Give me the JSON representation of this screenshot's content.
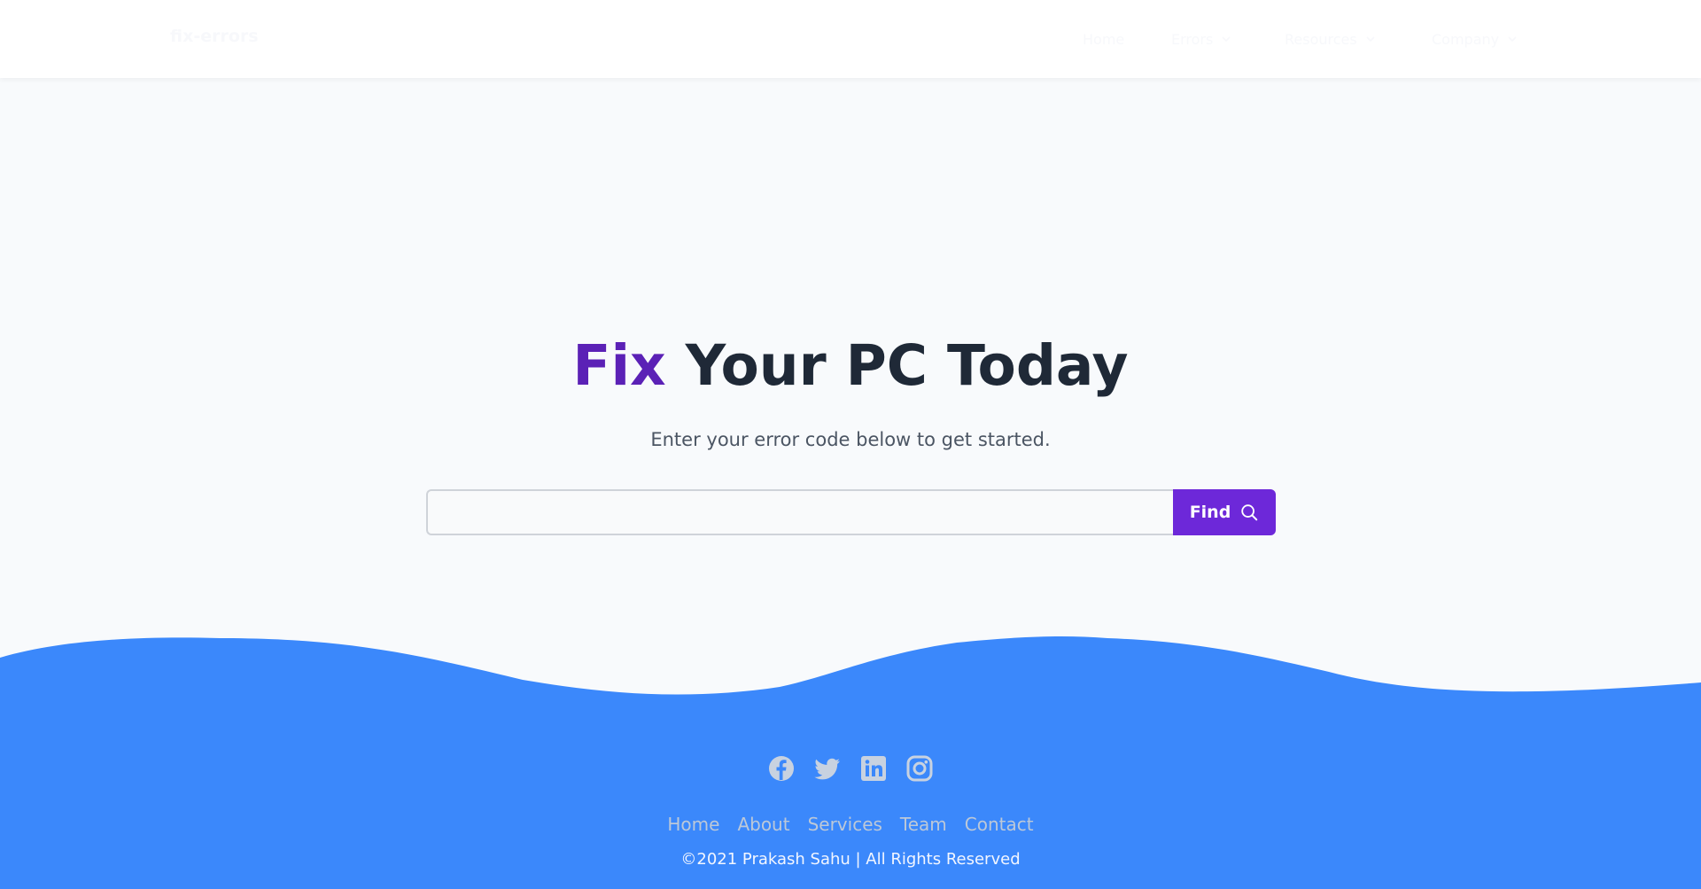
{
  "header": {
    "brand": "fix-errors",
    "nav": [
      {
        "label": "Home"
      },
      {
        "label": "Errors"
      },
      {
        "label": "Resources"
      },
      {
        "label": "Company"
      }
    ]
  },
  "hero": {
    "title_accent": "Fix",
    "title_rest": "Your PC Today",
    "subtitle": "Enter your error code below to get started.",
    "search": {
      "value": "",
      "placeholder": ""
    },
    "find_label": "Find"
  },
  "footer": {
    "social_icons": [
      "facebook-icon",
      "twitter-icon",
      "linkedin-icon",
      "instagram-icon"
    ],
    "links": [
      "Home",
      "About",
      "Services",
      "Team",
      "Contact"
    ],
    "copyright": "©2021 Prakash Sahu | All Rights Reserved"
  },
  "colors": {
    "accent": "#5b21b6",
    "button": "#6d28d9",
    "footer_bg": "#3b88fb",
    "page_bg": "#f8fafc"
  }
}
